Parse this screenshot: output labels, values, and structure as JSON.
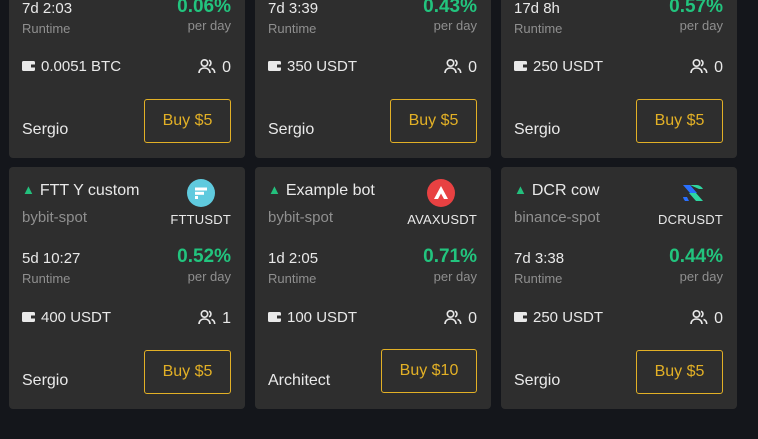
{
  "top_cards": [
    {
      "runtime": "7d 2:03",
      "runtime_label": "Runtime",
      "pct": "0.06%",
      "per_day": "per day",
      "investment": "0.0051 BTC",
      "users": "0",
      "owner": "Sergio",
      "buy_label": "Buy $5"
    },
    {
      "runtime": "7d 3:39",
      "runtime_label": "Runtime",
      "pct": "0.43%",
      "per_day": "per day",
      "investment": "350 USDT",
      "users": "0",
      "owner": "Sergio",
      "buy_label": "Buy $5"
    },
    {
      "runtime": "17d 8h",
      "runtime_label": "Runtime",
      "pct": "0.57%",
      "per_day": "per day",
      "investment": "250 USDT",
      "users": "0",
      "owner": "Sergio",
      "buy_label": "Buy $5"
    }
  ],
  "bottom_cards": [
    {
      "name": "FTT Y custom",
      "exchange": "bybit-spot",
      "pair": "FTTUSDT",
      "coin_icon": "ftt-icon",
      "coin_color": "#5fcade",
      "runtime": "5d 10:27",
      "runtime_label": "Runtime",
      "pct": "0.52%",
      "per_day": "per day",
      "investment": "400 USDT",
      "users": "1",
      "owner": "Sergio",
      "buy_label": "Buy $5"
    },
    {
      "name": "Example bot",
      "exchange": "bybit-spot",
      "pair": "AVAXUSDT",
      "coin_icon": "avax-icon",
      "coin_color": "#e84142",
      "runtime": "1d 2:05",
      "runtime_label": "Runtime",
      "pct": "0.71%",
      "per_day": "per day",
      "investment": "100 USDT",
      "users": "0",
      "owner": "Architect",
      "buy_label": "Buy $10"
    },
    {
      "name": "DCR cow",
      "exchange": "binance-spot",
      "pair": "DCRUSDT",
      "coin_icon": "dcr-icon",
      "coin_color": "#2ed6a1",
      "runtime": "7d 3:38",
      "runtime_label": "Runtime",
      "pct": "0.44%",
      "per_day": "per day",
      "investment": "250 USDT",
      "users": "0",
      "owner": "Sergio",
      "buy_label": "Buy $5"
    }
  ],
  "colors": {
    "accent": "#e2b026",
    "positive": "#22c47e",
    "card_bg": "#2e2e2e",
    "page_bg": "#14161b"
  }
}
